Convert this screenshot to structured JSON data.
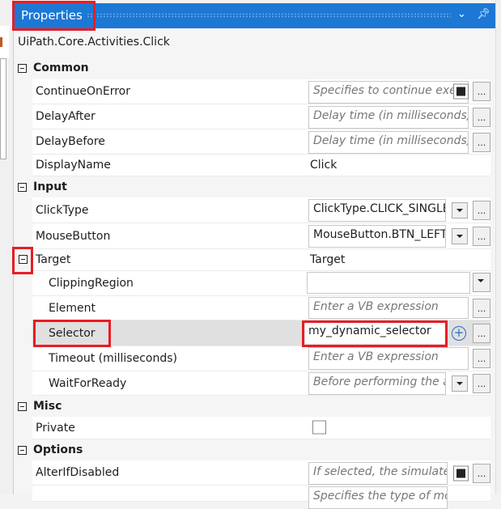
{
  "panel": {
    "title": "Properties",
    "activity": "UiPath.Core.Activities.Click",
    "icons": [
      "chevron-down-icon",
      "pin-icon"
    ]
  },
  "categories": {
    "common": "Common",
    "input": "Input",
    "misc": "Misc",
    "options": "Options"
  },
  "props": {
    "continue_on_error": {
      "name": "ContinueOnError",
      "placeholder": "Specifies to continue exec"
    },
    "delay_after": {
      "name": "DelayAfter",
      "placeholder": "Delay time (in milliseconds) a"
    },
    "delay_before": {
      "name": "DelayBefore",
      "placeholder": "Delay time (in milliseconds) b"
    },
    "display_name": {
      "name": "DisplayName",
      "value": "Click"
    },
    "click_type": {
      "name": "ClickType",
      "value": "ClickType.CLICK_SINGLE"
    },
    "mouse_button": {
      "name": "MouseButton",
      "value": "MouseButton.BTN_LEFT"
    },
    "target": {
      "name": "Target",
      "value": "Target"
    },
    "clipping_region": {
      "name": "ClippingRegion",
      "value": ""
    },
    "element": {
      "name": "Element",
      "placeholder": "Enter a VB expression"
    },
    "selector": {
      "name": "Selector",
      "value": "my_dynamic_selector"
    },
    "timeout": {
      "name": "Timeout (milliseconds)",
      "placeholder": "Enter a VB expression"
    },
    "wait_for_ready": {
      "name": "WaitForReady",
      "placeholder": "Before performing the act"
    },
    "private": {
      "name": "Private",
      "checked": false
    },
    "alter_if_disabled": {
      "name": "AlterIfDisabled",
      "placeholder": "If selected, the simulated"
    },
    "next": {
      "placeholder": "Specifies the type of mouse"
    }
  },
  "ellipsis": "...",
  "plus": "+"
}
